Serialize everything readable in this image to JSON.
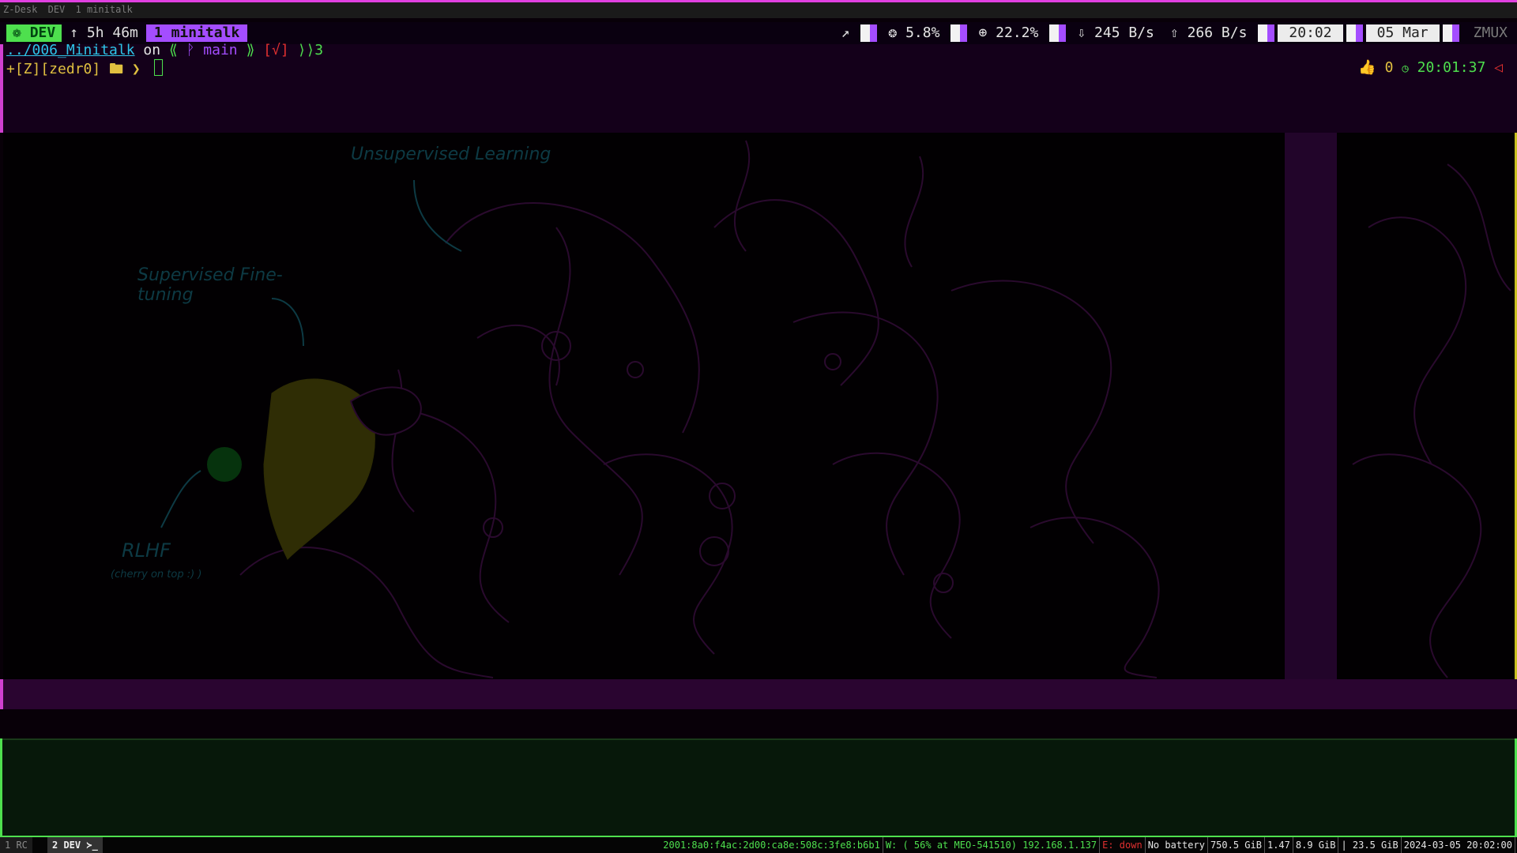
{
  "titlebar": {
    "app": "Z-Desk",
    "workspace": "DEV",
    "window": "1 minitalk"
  },
  "statusbar": {
    "session": "DEV",
    "uptime": "↑ 5h 46m",
    "window_tab": "1 minitalk",
    "cpu": "5.8%",
    "mem": "22.2%",
    "net_down": "245 B/s",
    "net_up": "266 B/s",
    "time": "20:02",
    "date": "05 Mar",
    "brand": "ZMUX"
  },
  "prompt": {
    "path": "../006_Minitalk",
    "on": "on",
    "branch_open": "⟪",
    "branch": "main",
    "branch_close": "⟫",
    "status": "[√]",
    "jobs": "⟩⟩3",
    "line2_prefix": "+[Z][zedr0]",
    "line2_chevron": "❯",
    "right_count": "0",
    "right_time": "20:01:37"
  },
  "artwork": {
    "labels": {
      "unsupervised": "Unsupervised Learning",
      "supervised": "Supervised Fine-tuning",
      "rlhf": "RLHF",
      "rlhf_sub": "(cherry on top :) )"
    }
  },
  "bottombar": {
    "ws1": "1 RC",
    "ws2": "2 DEV ≻_",
    "ipv6": "2001:8a0:f4ac:2d00:ca8e:508c:3fe8:b6b1",
    "wifi": "W: ( 56% at MEO-541510) 192.168.1.137",
    "eth": "E: down",
    "battery": "No battery",
    "disk": "750.5 GiB",
    "load": "1.47",
    "mem_used": "8.9 GiB",
    "mem_total": "| 23.5 GiB",
    "datetime": "2024-03-05 20:02:00"
  },
  "colors": {
    "accent_green": "#4ee04e",
    "accent_purple": "#a44dff",
    "accent_magenta": "#e040e0"
  }
}
